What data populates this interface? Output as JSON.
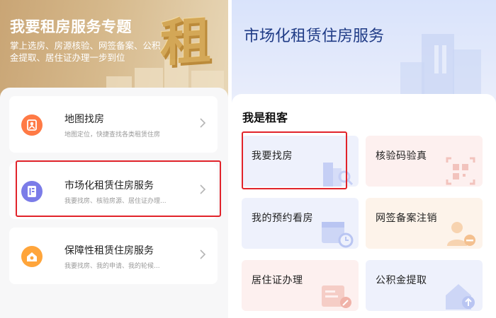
{
  "left": {
    "banner": {
      "title": "我要租房服务专题",
      "subtitle": "掌上选房、房源核验、网签备案、公积金提取、居住证办理一步到位",
      "glyph": "租"
    },
    "services": [
      {
        "title": "地图找房",
        "desc": "地图定位，快捷查找各类租赁住房",
        "icon": "map-pin-icon",
        "color": "#ff7a45"
      },
      {
        "title": "市场化租赁住房服务",
        "desc": "我要找房、核验房源、居住证办理...",
        "icon": "document-icon",
        "color": "#7b7ce8"
      },
      {
        "title": "保障性租赁住房服务",
        "desc": "我要找房、我的申请、我的轮候...",
        "icon": "house-icon",
        "color": "#ffa53b"
      }
    ]
  },
  "right": {
    "title": "市场化租赁住房服务",
    "section_title": "我是租客",
    "tiles": [
      {
        "label": "我要找房",
        "icon": "building-search-icon",
        "tint": "#eef1fc"
      },
      {
        "label": "核验码验真",
        "icon": "qr-scan-icon",
        "tint": "#fdf0ef"
      },
      {
        "label": "我的预约看房",
        "icon": "calendar-clock-icon",
        "tint": "#eef1fc"
      },
      {
        "label": "网签备案注销",
        "icon": "user-remove-icon",
        "tint": "#fdf3ea"
      },
      {
        "label": "居住证办理",
        "icon": "card-edit-icon",
        "tint": "#fdf0ef"
      },
      {
        "label": "公积金提取",
        "icon": "house-upload-icon",
        "tint": "#eef1fc"
      }
    ]
  }
}
